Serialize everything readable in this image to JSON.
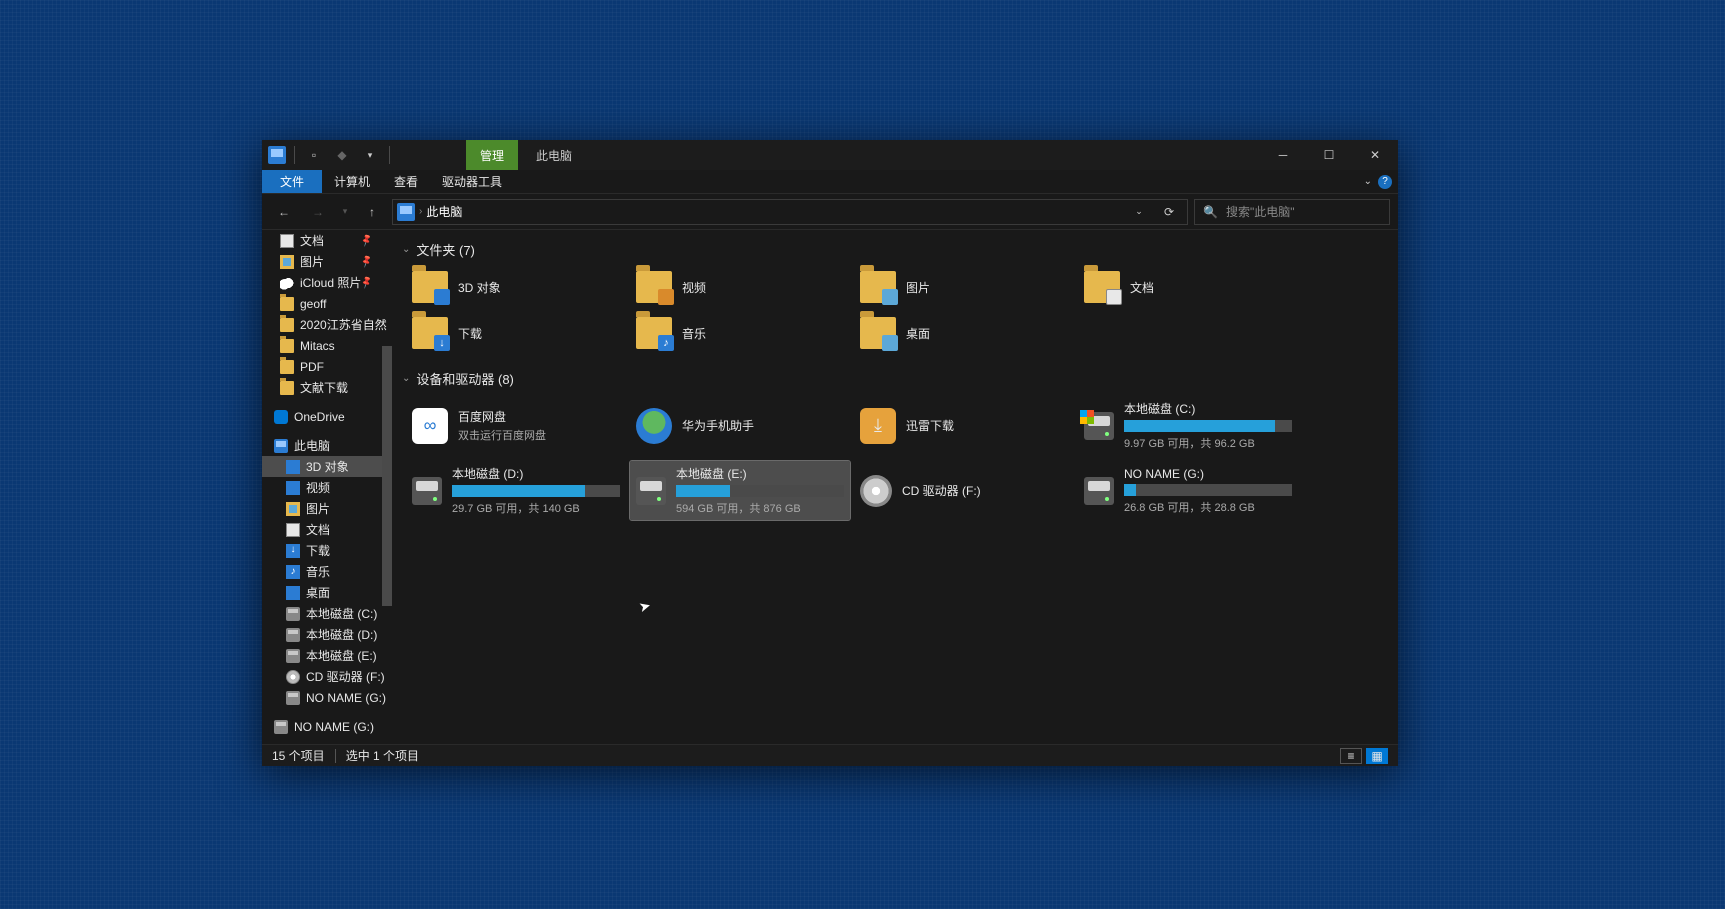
{
  "titlebar": {
    "context_tab": "管理",
    "title": "此电脑"
  },
  "menu": {
    "file": "文件",
    "computer": "计算机",
    "view": "查看",
    "drive_tools": "驱动器工具"
  },
  "nav": {
    "location": "此电脑",
    "refresh_title": "刷新"
  },
  "search": {
    "placeholder": "搜索\"此电脑\""
  },
  "sidebar": {
    "quick": [
      {
        "label": "文档",
        "icon": "doc",
        "pin": true
      },
      {
        "label": "图片",
        "icon": "pic",
        "pin": true
      },
      {
        "label": "iCloud 照片",
        "icon": "cloud",
        "pin": true
      },
      {
        "label": "geoff",
        "icon": "folder"
      },
      {
        "label": "2020江苏省自然",
        "icon": "folder"
      },
      {
        "label": "Mitacs",
        "icon": "folder"
      },
      {
        "label": "PDF",
        "icon": "folder"
      },
      {
        "label": "文献下载",
        "icon": "folder"
      }
    ],
    "onedrive": "OneDrive",
    "this_pc": "此电脑",
    "this_pc_children": [
      {
        "label": "3D 对象",
        "icon": "3d",
        "selected": true
      },
      {
        "label": "视频",
        "icon": "video"
      },
      {
        "label": "图片",
        "icon": "pic"
      },
      {
        "label": "文档",
        "icon": "doc"
      },
      {
        "label": "下载",
        "icon": "dl"
      },
      {
        "label": "音乐",
        "icon": "music"
      },
      {
        "label": "桌面",
        "icon": "desk"
      },
      {
        "label": "本地磁盘 (C:)",
        "icon": "drive"
      },
      {
        "label": "本地磁盘 (D:)",
        "icon": "drive"
      },
      {
        "label": "本地磁盘 (E:)",
        "icon": "drive"
      },
      {
        "label": "CD 驱动器 (F:)",
        "icon": "cd"
      },
      {
        "label": "NO NAME (G:)",
        "icon": "drive"
      }
    ],
    "removable": "NO NAME (G:)"
  },
  "content": {
    "folders_header": "文件夹 (7)",
    "folders": [
      {
        "label": "3D 对象",
        "badge": "3d"
      },
      {
        "label": "视频",
        "badge": "vid"
      },
      {
        "label": "图片",
        "badge": "pic"
      },
      {
        "label": "文档",
        "badge": "doc"
      },
      {
        "label": "下载",
        "badge": "dl"
      },
      {
        "label": "音乐",
        "badge": "mus"
      },
      {
        "label": "桌面",
        "badge": "desk"
      }
    ],
    "drives_header": "设备和驱动器 (8)",
    "apps": [
      {
        "label": "百度网盘",
        "sub": "双击运行百度网盘",
        "cls": "app-baidu",
        "glyph": "∞"
      },
      {
        "label": "华为手机助手",
        "cls": "app-huawei",
        "glyph": ""
      },
      {
        "label": "迅雷下载",
        "cls": "app-xunlei",
        "glyph": "⤓"
      }
    ],
    "drive_c": {
      "label": "本地磁盘 (C:)",
      "free": "9.97 GB 可用，共 96.2 GB",
      "pct": 90
    },
    "drive_d": {
      "label": "本地磁盘 (D:)",
      "free": "29.7 GB 可用，共 140 GB",
      "pct": 79
    },
    "drive_e": {
      "label": "本地磁盘 (E:)",
      "free": "594 GB 可用，共 876 GB",
      "pct": 32,
      "selected": true
    },
    "drive_f": {
      "label": "CD 驱动器 (F:)"
    },
    "drive_g": {
      "label": "NO NAME (G:)",
      "free": "26.8 GB 可用，共 28.8 GB",
      "pct": 7
    }
  },
  "status": {
    "count": "15 个项目",
    "selection": "选中 1 个项目"
  }
}
